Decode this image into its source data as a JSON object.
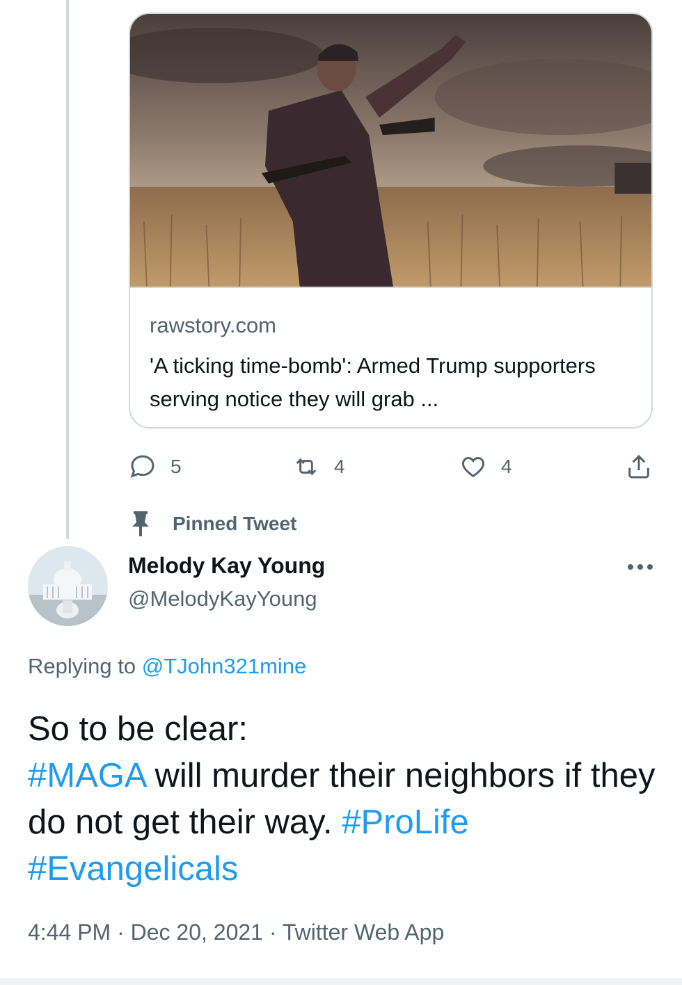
{
  "link_card": {
    "domain": "rawstory.com",
    "title": "'A ticking time-bomb': Armed Trump supporters serving notice they will grab ..."
  },
  "actions": {
    "reply_count": "5",
    "retweet_count": "4",
    "like_count": "4"
  },
  "pinned": {
    "label": "Pinned Tweet"
  },
  "author": {
    "display_name": "Melody Kay Young",
    "handle": "@MelodyKayYoung"
  },
  "reply_context": {
    "prefix": "Replying to ",
    "mention": "@TJohn321mine"
  },
  "tweet": {
    "line1": "So to be clear:",
    "tag_maga": "#MAGA",
    "text_mid": " will murder their neighbors if they do not get their way. ",
    "tag_prolife": "#ProLife",
    "tag_evangelicals": "#Evangelicals"
  },
  "meta": {
    "timestamp": "4:44 PM · Dec 20, 2021 · Twitter Web App"
  },
  "colors": {
    "accent": "#1d9bf0",
    "secondary_text": "#536471",
    "border": "#cfd9de"
  },
  "icons": [
    "reply-icon",
    "retweet-icon",
    "like-icon",
    "share-icon",
    "pin-icon",
    "more-icon"
  ]
}
